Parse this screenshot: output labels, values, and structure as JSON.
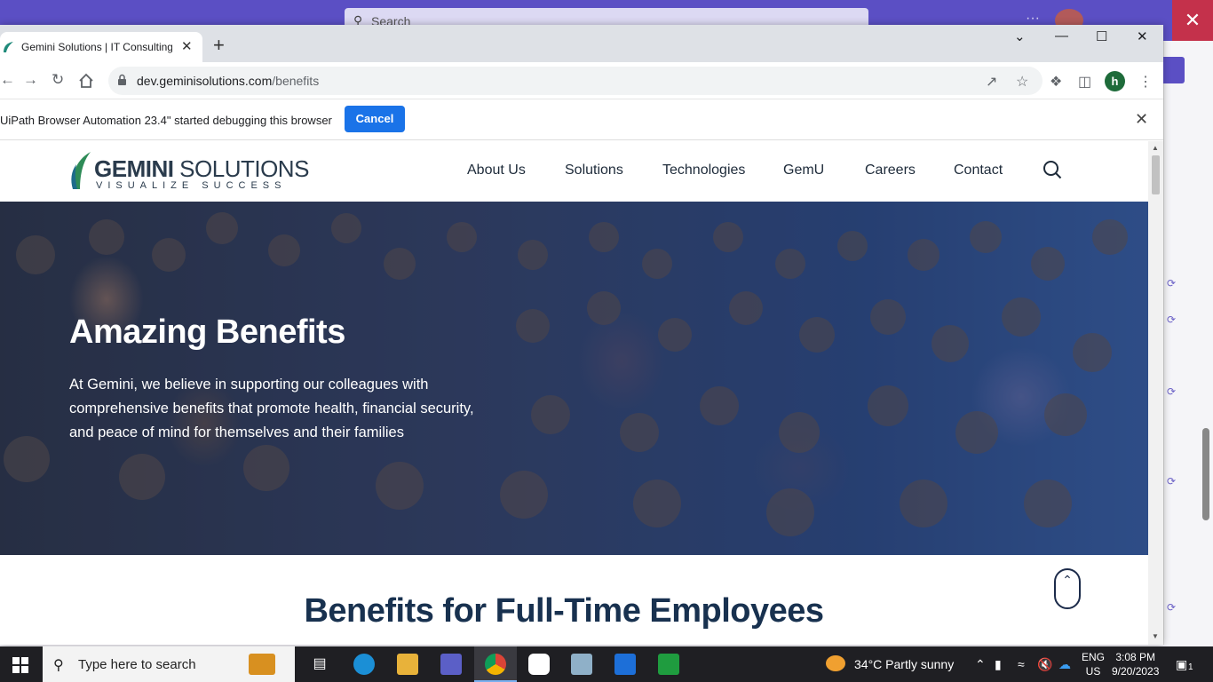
{
  "background_app": {
    "search_placeholder": "Search"
  },
  "browser": {
    "tab": {
      "title": "Gemini Solutions | IT Consulting"
    },
    "address": {
      "host": "dev.geminisolutions.com",
      "path": "/benefits"
    },
    "profile_initial": "h",
    "infobar": {
      "message": "UiPath Browser Automation 23.4\" started debugging this browser",
      "cancel_label": "Cancel"
    }
  },
  "site": {
    "logo": {
      "name_bold": "GEMINI",
      "name_rest": " SOLUTIONS",
      "tagline": "VISUALIZE SUCCESS"
    },
    "nav": [
      "About Us",
      "Solutions",
      "Technologies",
      "GemU",
      "Careers",
      "Contact"
    ],
    "hero": {
      "title": "Amazing Benefits",
      "text": "At Gemini, we believe in supporting our colleagues with comprehensive benefits that promote health, financial security, and peace of mind for themselves and their families"
    },
    "section_title": "Benefits for Full-Time Employees"
  },
  "taskbar": {
    "search_placeholder": "Type here to search",
    "weather": "34°C  Partly sunny",
    "lang_line1": "ENG",
    "lang_line2": "US",
    "time": "3:08 PM",
    "date": "9/20/2023",
    "notification_count": "1"
  }
}
